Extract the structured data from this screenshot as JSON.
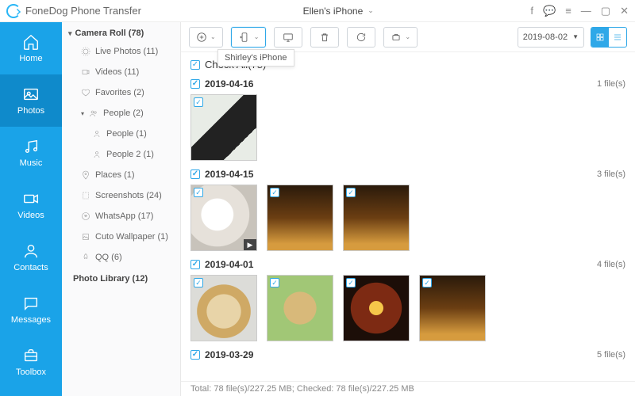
{
  "app": {
    "title": "FoneDog Phone Transfer",
    "device": "Ellen's iPhone"
  },
  "title_icons": {
    "feedback": "f",
    "chat": "💬",
    "menu": "≡",
    "min": "—",
    "max": "▢",
    "close": "✕"
  },
  "nav": [
    {
      "key": "home",
      "label": "Home"
    },
    {
      "key": "photos",
      "label": "Photos"
    },
    {
      "key": "music",
      "label": "Music"
    },
    {
      "key": "videos",
      "label": "Videos"
    },
    {
      "key": "contacts",
      "label": "Contacts"
    },
    {
      "key": "messages",
      "label": "Messages"
    },
    {
      "key": "toolbox",
      "label": "Toolbox"
    }
  ],
  "sidebar": {
    "group": "Camera Roll (78)",
    "items": [
      {
        "label": "Live Photos (11)"
      },
      {
        "label": "Videos (11)"
      },
      {
        "label": "Favorites (2)"
      },
      {
        "label": "People (2)",
        "expandable": true
      },
      {
        "label": "People (1)",
        "deep": true
      },
      {
        "label": "People 2 (1)",
        "deep": true
      },
      {
        "label": "Places (1)"
      },
      {
        "label": "Screenshots (24)"
      },
      {
        "label": "WhatsApp (17)"
      },
      {
        "label": "Cuto Wallpaper (1)"
      },
      {
        "label": "QQ (6)"
      }
    ],
    "library": "Photo Library (12)"
  },
  "toolbar": {
    "tooltip": "Shirley's iPhone",
    "date": "2019-08-02"
  },
  "content": {
    "checkall": "Check All(78)",
    "groups": [
      {
        "date": "2019-04-16",
        "count": "1 file(s)",
        "thumbs": [
          {
            "cls": "im-phone"
          }
        ]
      },
      {
        "date": "2019-04-15",
        "count": "3 file(s)",
        "thumbs": [
          {
            "cls": "im-mug",
            "video": true
          },
          {
            "cls": "im-drinks"
          },
          {
            "cls": "im-drinks"
          }
        ]
      },
      {
        "date": "2019-04-01",
        "count": "4 file(s)",
        "thumbs": [
          {
            "cls": "im-dog1"
          },
          {
            "cls": "im-dog2"
          },
          {
            "cls": "im-lights"
          },
          {
            "cls": "im-drinks"
          }
        ]
      },
      {
        "date": "2019-03-29",
        "count": "5 file(s)",
        "thumbs": []
      }
    ]
  },
  "status": "Total: 78 file(s)/227.25 MB; Checked: 78 file(s)/227.25 MB"
}
